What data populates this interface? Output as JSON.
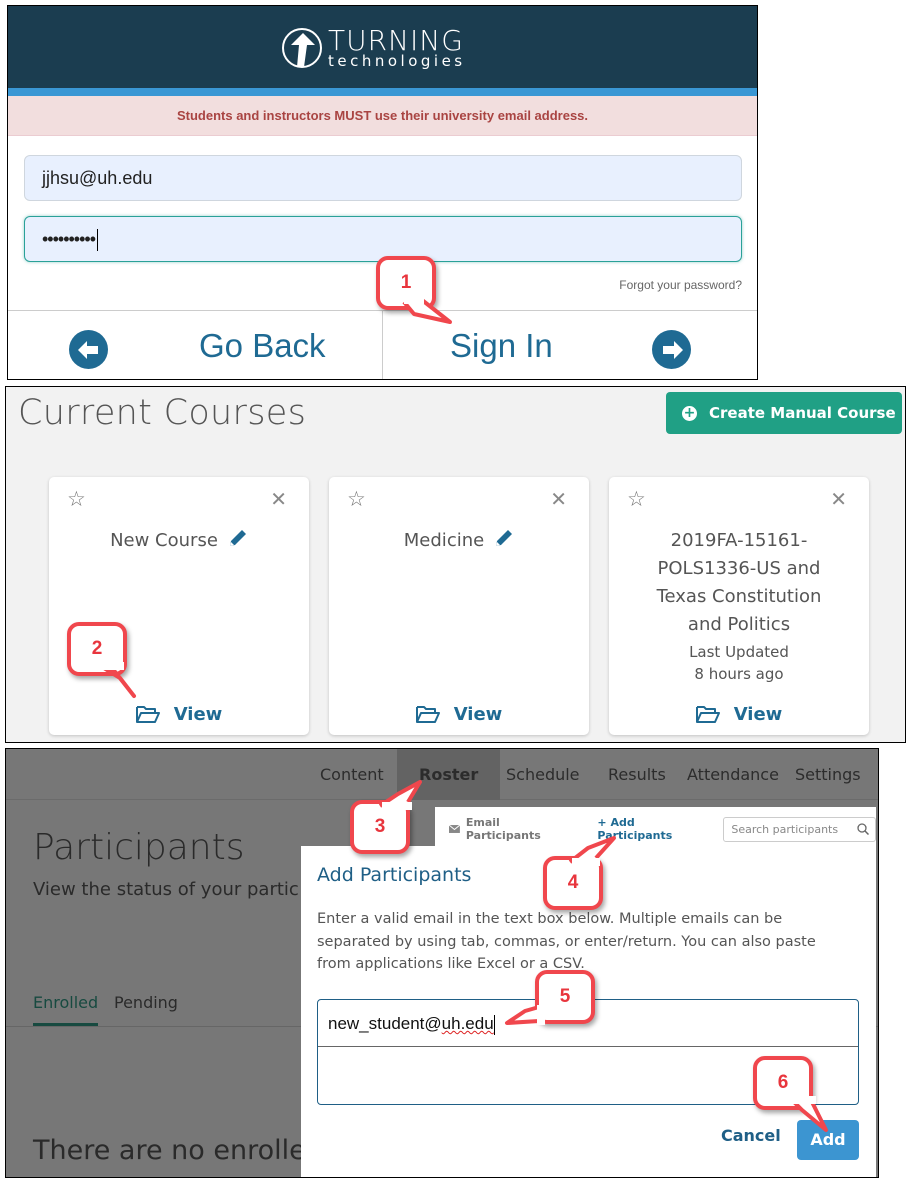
{
  "login": {
    "logo": {
      "word1": "TURNING",
      "word2": "technologies",
      "icon": "turning-arrow-logo-icon"
    },
    "notice": "Students and instructors MUST use their university email address.",
    "email_value": "jjhsu@uh.edu",
    "password_value": "••••••••••",
    "forgot_link": "Forgot your password?",
    "go_back_label": "Go Back",
    "sign_in_label": "Sign In",
    "colors": {
      "header": "#1b3d50",
      "stripe": "#3a97d4",
      "notice_bg": "#f2dede",
      "notice_text": "#a94442",
      "button_text": "#1f6a93"
    }
  },
  "courses": {
    "title": "Current Courses",
    "create_button": "Create Manual Course",
    "cards": [
      {
        "name": "New Course",
        "editable": true,
        "updated_label": "",
        "updated_value": "",
        "view_label": "View"
      },
      {
        "name": "Medicine",
        "editable": true,
        "updated_label": "",
        "updated_value": "",
        "view_label": "View"
      },
      {
        "name": "2019FA-15161-POLS1336-US and Texas Constitution and Politics",
        "name_lines": [
          "2019FA-15161-",
          "POLS1336-US and",
          "Texas Constitution",
          "and Politics"
        ],
        "editable": false,
        "updated_label": "Last Updated",
        "updated_value": "8 hours ago",
        "view_label": "View"
      }
    ],
    "colors": {
      "create_button": "#20a085",
      "view_link": "#1f6a93"
    }
  },
  "roster": {
    "nav": [
      "Content",
      "Roster",
      "Schedule",
      "Results",
      "Attendance",
      "Settings"
    ],
    "active_nav": "Roster",
    "page_title": "Participants",
    "page_subtitle": "View the status of your partic",
    "tabs": [
      "Enrolled",
      "Pending"
    ],
    "active_tab": "Enrolled",
    "empty_message": "There are no enrolled",
    "toolbar": {
      "email_participants": "Email Participants",
      "add_participants": "+ Add Participants",
      "search_placeholder": "Search participants"
    },
    "dialog": {
      "title": "Add Participants",
      "description": "Enter a valid email in the text box below. Multiple emails can be separated by using tab, commas, or enter/return. You can also paste from applications like Excel or a CSV.",
      "email_prefix": "new_student@",
      "email_domain": "uh.edu",
      "cancel_label": "Cancel",
      "add_label": "Add"
    }
  },
  "callouts": [
    "1",
    "2",
    "3",
    "4",
    "5",
    "6"
  ],
  "callout_color": "#f0474d"
}
